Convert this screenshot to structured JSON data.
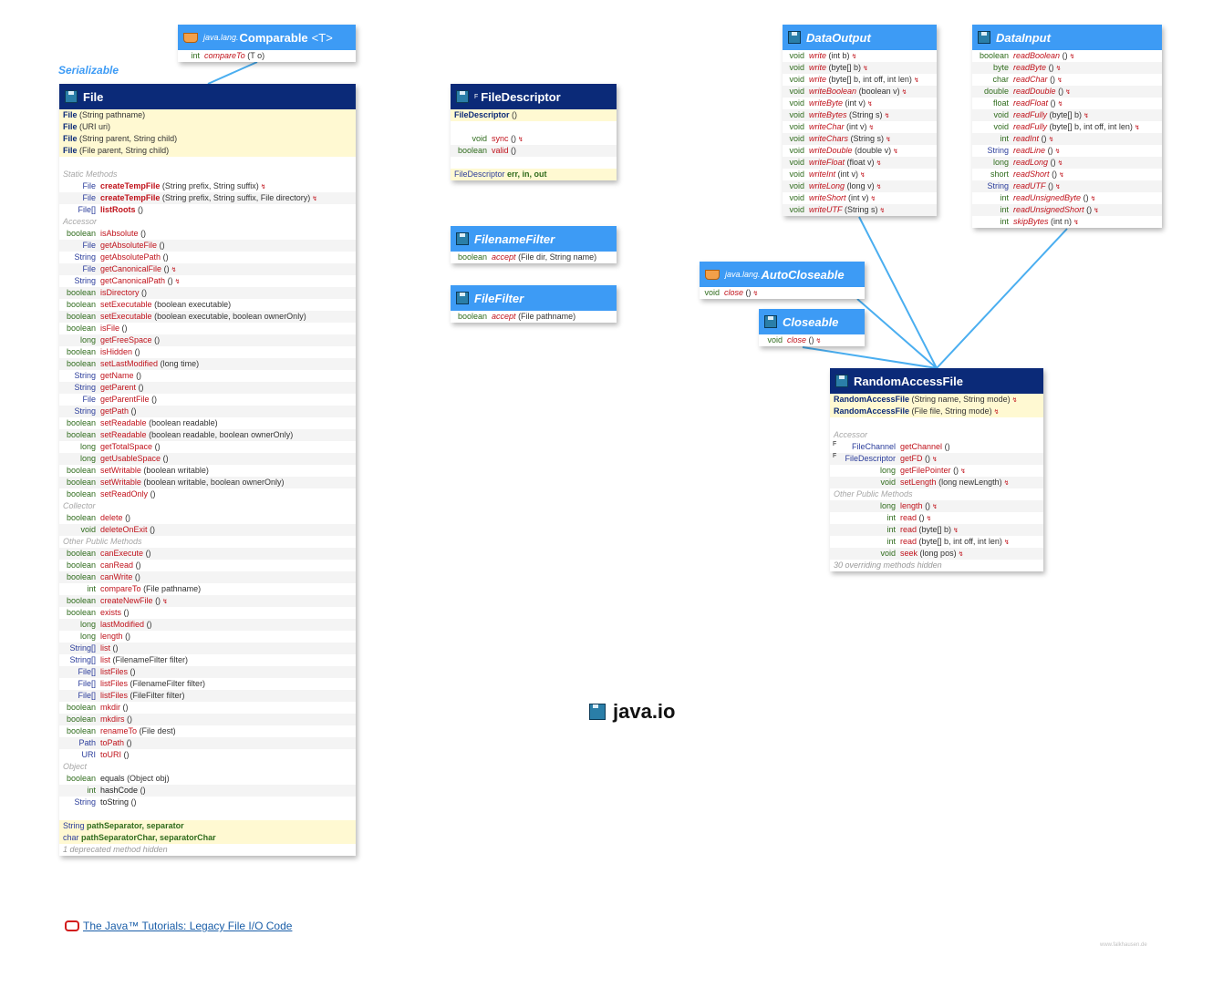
{
  "package_title": "java.io",
  "serializable_label": "Serializable",
  "footer": {
    "tutorial_link": "The Java™ Tutorials: Legacy File I/O Code",
    "watermark": "www.falkhausen.de"
  },
  "colors": {
    "header_dark": "#0b2a78",
    "header_light": "#3d9bf5",
    "connector": "#4aaef0",
    "method_red": "#c0121b",
    "type_blue": "#2b3d9b",
    "ctor_bg": "#fff9d2"
  },
  "icons": {
    "class": "java-class-icon",
    "interface": "java-interface-icon",
    "external": "coffee-cup-icon",
    "tutorial": "oracle-logo-icon"
  },
  "comparable": {
    "pkg": "java.lang.",
    "name": "Comparable",
    "type_param": "<T>",
    "rows": [
      {
        "k": "m",
        "t": "int",
        "name": "compareTo",
        "params": "(T o)",
        "it": true
      }
    ]
  },
  "file": {
    "name": "File",
    "rows": [
      {
        "k": "c",
        "name": "File",
        "params": "(String pathname)"
      },
      {
        "k": "c",
        "name": "File",
        "params": "(URI uri)"
      },
      {
        "k": "c",
        "name": "File",
        "params": "(String parent, String child)"
      },
      {
        "k": "c",
        "name": "File",
        "params": "(File parent, String child)"
      },
      {
        "k": "b"
      },
      {
        "k": "s",
        "text": "Static Methods"
      },
      {
        "k": "m",
        "t": "File",
        "name": "createTempFile",
        "params": "(String prefix, String suffix)",
        "ex": true,
        "bold": true
      },
      {
        "k": "m",
        "t": "File",
        "name": "createTempFile",
        "params": "(String prefix, String suffix, File directory)",
        "ex": true,
        "bold": true
      },
      {
        "k": "m",
        "t": "File[]",
        "name": "listRoots",
        "params": "()",
        "bold": true
      },
      {
        "k": "s",
        "text": "Accessor"
      },
      {
        "k": "m",
        "t": "boolean",
        "name": "isAbsolute",
        "params": "()"
      },
      {
        "k": "m",
        "t": "File",
        "name": "getAbsoluteFile",
        "params": "()"
      },
      {
        "k": "m",
        "t": "String",
        "name": "getAbsolutePath",
        "params": "()"
      },
      {
        "k": "m",
        "t": "File",
        "name": "getCanonicalFile",
        "params": "()",
        "ex": true
      },
      {
        "k": "m",
        "t": "String",
        "name": "getCanonicalPath",
        "params": "()",
        "ex": true
      },
      {
        "k": "m",
        "t": "boolean",
        "name": "isDirectory",
        "params": "()"
      },
      {
        "k": "m",
        "t": "boolean",
        "name": "setExecutable",
        "params": "(boolean executable)"
      },
      {
        "k": "m",
        "t": "boolean",
        "name": "setExecutable",
        "params": "(boolean executable, boolean ownerOnly)"
      },
      {
        "k": "m",
        "t": "boolean",
        "name": "isFile",
        "params": "()"
      },
      {
        "k": "m",
        "t": "long",
        "name": "getFreeSpace",
        "params": "()"
      },
      {
        "k": "m",
        "t": "boolean",
        "name": "isHidden",
        "params": "()"
      },
      {
        "k": "m",
        "t": "boolean",
        "name": "setLastModified",
        "params": "(long time)"
      },
      {
        "k": "m",
        "t": "String",
        "name": "getName",
        "params": "()"
      },
      {
        "k": "m",
        "t": "String",
        "name": "getParent",
        "params": "()"
      },
      {
        "k": "m",
        "t": "File",
        "name": "getParentFile",
        "params": "()"
      },
      {
        "k": "m",
        "t": "String",
        "name": "getPath",
        "params": "()"
      },
      {
        "k": "m",
        "t": "boolean",
        "name": "setReadable",
        "params": "(boolean readable)"
      },
      {
        "k": "m",
        "t": "boolean",
        "name": "setReadable",
        "params": "(boolean readable, boolean ownerOnly)"
      },
      {
        "k": "m",
        "t": "long",
        "name": "getTotalSpace",
        "params": "()"
      },
      {
        "k": "m",
        "t": "long",
        "name": "getUsableSpace",
        "params": "()"
      },
      {
        "k": "m",
        "t": "boolean",
        "name": "setWritable",
        "params": "(boolean writable)"
      },
      {
        "k": "m",
        "t": "boolean",
        "name": "setWritable",
        "params": "(boolean writable, boolean ownerOnly)"
      },
      {
        "k": "m",
        "t": "boolean",
        "name": "setReadOnly",
        "params": "()"
      },
      {
        "k": "s",
        "text": "Collector"
      },
      {
        "k": "m",
        "t": "boolean",
        "name": "delete",
        "params": "()"
      },
      {
        "k": "m",
        "t": "void",
        "name": "deleteOnExit",
        "params": "()"
      },
      {
        "k": "s",
        "text": "Other Public Methods"
      },
      {
        "k": "m",
        "t": "boolean",
        "name": "canExecute",
        "params": "()"
      },
      {
        "k": "m",
        "t": "boolean",
        "name": "canRead",
        "params": "()"
      },
      {
        "k": "m",
        "t": "boolean",
        "name": "canWrite",
        "params": "()"
      },
      {
        "k": "m",
        "t": "int",
        "name": "compareTo",
        "params": "(File pathname)"
      },
      {
        "k": "m",
        "t": "boolean",
        "name": "createNewFile",
        "params": "()",
        "ex": true
      },
      {
        "k": "m",
        "t": "boolean",
        "name": "exists",
        "params": "()"
      },
      {
        "k": "m",
        "t": "long",
        "name": "lastModified",
        "params": "()"
      },
      {
        "k": "m",
        "t": "long",
        "name": "length",
        "params": "()"
      },
      {
        "k": "m",
        "t": "String[]",
        "name": "list",
        "params": "()"
      },
      {
        "k": "m",
        "t": "String[]",
        "name": "list",
        "params": "(FilenameFilter filter)"
      },
      {
        "k": "m",
        "t": "File[]",
        "name": "listFiles",
        "params": "()"
      },
      {
        "k": "m",
        "t": "File[]",
        "name": "listFiles",
        "params": "(FilenameFilter filter)"
      },
      {
        "k": "m",
        "t": "File[]",
        "name": "listFiles",
        "params": "(FileFilter filter)"
      },
      {
        "k": "m",
        "t": "boolean",
        "name": "mkdir",
        "params": "()"
      },
      {
        "k": "m",
        "t": "boolean",
        "name": "mkdirs",
        "params": "()"
      },
      {
        "k": "m",
        "t": "boolean",
        "name": "renameTo",
        "params": "(File dest)"
      },
      {
        "k": "m",
        "t": "Path",
        "name": "toPath",
        "params": "()"
      },
      {
        "k": "m",
        "t": "URI",
        "name": "toURI",
        "params": "()"
      },
      {
        "k": "s",
        "text": "Object"
      },
      {
        "k": "m",
        "t": "boolean",
        "name": "equals",
        "params": "(Object obj)",
        "plain": true
      },
      {
        "k": "m",
        "t": "int",
        "name": "hashCode",
        "params": "()",
        "plain": true
      },
      {
        "k": "m",
        "t": "String",
        "name": "toString",
        "params": "()",
        "plain": true
      },
      {
        "k": "b"
      },
      {
        "k": "f",
        "t": "String",
        "names": "pathSeparator, separator"
      },
      {
        "k": "f",
        "t": "char",
        "names": "pathSeparatorChar, separatorChar"
      },
      {
        "k": "n",
        "a": "1 deprecated",
        "b": "method hidden"
      }
    ]
  },
  "filedescriptor": {
    "name": "FileDescriptor",
    "final_mark": "F",
    "rows": [
      {
        "k": "c",
        "name": "FileDescriptor",
        "params": "()"
      },
      {
        "k": "b"
      },
      {
        "k": "m",
        "t": "void",
        "name": "sync",
        "params": "()",
        "ex": true
      },
      {
        "k": "m",
        "t": "boolean",
        "name": "valid",
        "params": "()"
      },
      {
        "k": "b"
      },
      {
        "k": "f",
        "t": "FileDescriptor",
        "names": "err, in, out"
      }
    ]
  },
  "filenamefilter": {
    "name": "FilenameFilter",
    "rows": [
      {
        "k": "m",
        "t": "boolean",
        "name": "accept",
        "params": "(File dir, String name)",
        "it": true
      }
    ]
  },
  "filefilter": {
    "name": "FileFilter",
    "rows": [
      {
        "k": "m",
        "t": "boolean",
        "name": "accept",
        "params": "(File pathname)",
        "it": true
      }
    ]
  },
  "dataoutput": {
    "name": "DataOutput",
    "rows": [
      {
        "k": "m",
        "t": "void",
        "name": "write",
        "params": "(int b)",
        "ex": true,
        "it": true
      },
      {
        "k": "m",
        "t": "void",
        "name": "write",
        "params": "(byte[] b)",
        "ex": true,
        "it": true
      },
      {
        "k": "m",
        "t": "void",
        "name": "write",
        "params": "(byte[] b, int off, int len)",
        "ex": true,
        "it": true
      },
      {
        "k": "m",
        "t": "void",
        "name": "writeBoolean",
        "params": "(boolean v)",
        "ex": true,
        "it": true
      },
      {
        "k": "m",
        "t": "void",
        "name": "writeByte",
        "params": "(int v)",
        "ex": true,
        "it": true
      },
      {
        "k": "m",
        "t": "void",
        "name": "writeBytes",
        "params": "(String s)",
        "ex": true,
        "it": true
      },
      {
        "k": "m",
        "t": "void",
        "name": "writeChar",
        "params": "(int v)",
        "ex": true,
        "it": true
      },
      {
        "k": "m",
        "t": "void",
        "name": "writeChars",
        "params": "(String s)",
        "ex": true,
        "it": true
      },
      {
        "k": "m",
        "t": "void",
        "name": "writeDouble",
        "params": "(double v)",
        "ex": true,
        "it": true
      },
      {
        "k": "m",
        "t": "void",
        "name": "writeFloat",
        "params": "(float v)",
        "ex": true,
        "it": true
      },
      {
        "k": "m",
        "t": "void",
        "name": "writeInt",
        "params": "(int v)",
        "ex": true,
        "it": true
      },
      {
        "k": "m",
        "t": "void",
        "name": "writeLong",
        "params": "(long v)",
        "ex": true,
        "it": true
      },
      {
        "k": "m",
        "t": "void",
        "name": "writeShort",
        "params": "(int v)",
        "ex": true,
        "it": true
      },
      {
        "k": "m",
        "t": "void",
        "name": "writeUTF",
        "params": "(String s)",
        "ex": true,
        "it": true
      }
    ]
  },
  "datainput": {
    "name": "DataInput",
    "rows": [
      {
        "k": "m",
        "t": "boolean",
        "name": "readBoolean",
        "params": "()",
        "ex": true,
        "it": true
      },
      {
        "k": "m",
        "t": "byte",
        "name": "readByte",
        "params": "()",
        "ex": true,
        "it": true
      },
      {
        "k": "m",
        "t": "char",
        "name": "readChar",
        "params": "()",
        "ex": true,
        "it": true
      },
      {
        "k": "m",
        "t": "double",
        "name": "readDouble",
        "params": "()",
        "ex": true,
        "it": true
      },
      {
        "k": "m",
        "t": "float",
        "name": "readFloat",
        "params": "()",
        "ex": true,
        "it": true
      },
      {
        "k": "m",
        "t": "void",
        "name": "readFully",
        "params": "(byte[] b)",
        "ex": true,
        "it": true
      },
      {
        "k": "m",
        "t": "void",
        "name": "readFully",
        "params": "(byte[] b, int off, int len)",
        "ex": true,
        "it": true
      },
      {
        "k": "m",
        "t": "int",
        "name": "readInt",
        "params": "()",
        "ex": true,
        "it": true
      },
      {
        "k": "m",
        "t": "String",
        "name": "readLine",
        "params": "()",
        "ex": true,
        "it": true
      },
      {
        "k": "m",
        "t": "long",
        "name": "readLong",
        "params": "()",
        "ex": true,
        "it": true
      },
      {
        "k": "m",
        "t": "short",
        "name": "readShort",
        "params": "()",
        "ex": true,
        "it": true
      },
      {
        "k": "m",
        "t": "String",
        "name": "readUTF",
        "params": "()",
        "ex": true,
        "it": true
      },
      {
        "k": "m",
        "t": "int",
        "name": "readUnsignedByte",
        "params": "()",
        "ex": true,
        "it": true
      },
      {
        "k": "m",
        "t": "int",
        "name": "readUnsignedShort",
        "params": "()",
        "ex": true,
        "it": true
      },
      {
        "k": "m",
        "t": "int",
        "name": "skipBytes",
        "params": "(int n)",
        "ex": true,
        "it": true
      }
    ]
  },
  "autocloseable": {
    "pkg": "java.lang.",
    "name": "AutoCloseable",
    "rows": [
      {
        "k": "m",
        "t": "void",
        "name": "close",
        "params": "()",
        "ex": true,
        "it": true
      }
    ]
  },
  "closeable": {
    "name": "Closeable",
    "rows": [
      {
        "k": "m",
        "t": "void",
        "name": "close",
        "params": "()",
        "ex": true,
        "it": true
      }
    ]
  },
  "randomaccessfile": {
    "name": "RandomAccessFile",
    "rows": [
      {
        "k": "c",
        "name": "RandomAccessFile",
        "params": "(String name, String mode)",
        "ex": true
      },
      {
        "k": "c",
        "name": "RandomAccessFile",
        "params": "(File file, String mode)",
        "ex": true
      },
      {
        "k": "b"
      },
      {
        "k": "s",
        "text": "Accessor"
      },
      {
        "k": "m",
        "t": "FileChannel",
        "name": "getChannel",
        "params": "()",
        "fm": "F"
      },
      {
        "k": "m",
        "t": "FileDescriptor",
        "name": "getFD",
        "params": "()",
        "ex": true,
        "fm": "F"
      },
      {
        "k": "m",
        "t": "long",
        "name": "getFilePointer",
        "params": "()",
        "ex": true
      },
      {
        "k": "m",
        "t": "void",
        "name": "setLength",
        "params": "(long newLength)",
        "ex": true
      },
      {
        "k": "s",
        "text": "Other Public Methods"
      },
      {
        "k": "m",
        "t": "long",
        "name": "length",
        "params": "()",
        "ex": true
      },
      {
        "k": "m",
        "t": "int",
        "name": "read",
        "params": "()",
        "ex": true
      },
      {
        "k": "m",
        "t": "int",
        "name": "read",
        "params": "(byte[] b)",
        "ex": true
      },
      {
        "k": "m",
        "t": "int",
        "name": "read",
        "params": "(byte[] b, int off, int len)",
        "ex": true
      },
      {
        "k": "m",
        "t": "void",
        "name": "seek",
        "params": "(long pos)",
        "ex": true
      },
      {
        "k": "n",
        "a": "30 overriding",
        "b": "methods hidden"
      }
    ]
  }
}
